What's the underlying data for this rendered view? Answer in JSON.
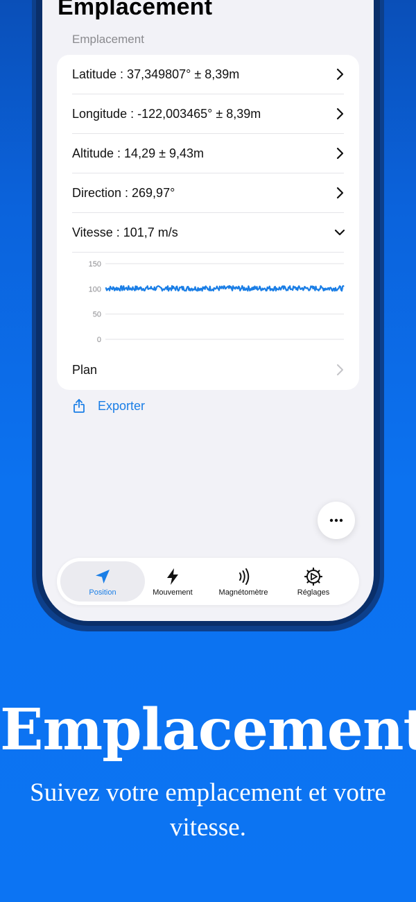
{
  "header": {
    "title": "Emplacement"
  },
  "section": {
    "label": "Emplacement"
  },
  "rows": [
    {
      "label": "Latitude : 37,349807° ± 8,39m",
      "expanded": false
    },
    {
      "label": "Longitude : -122,003465° ± 8,39m",
      "expanded": false
    },
    {
      "label": "Altitude : 14,29 ± 9,43m",
      "expanded": false
    },
    {
      "label": "Direction : 269,97°",
      "expanded": false
    },
    {
      "label": "Vitesse : 101,7 m/s",
      "expanded": true
    }
  ],
  "chart_data": {
    "type": "line",
    "y_ticks": [
      "150",
      "100",
      "50",
      "0"
    ],
    "ylim": [
      0,
      150
    ],
    "series": [
      {
        "values_approx": 101.7,
        "noise_range": [
          96,
          106
        ],
        "color": "#1a7ee6"
      }
    ],
    "grid": true
  },
  "plan": {
    "label": "Plan"
  },
  "export": {
    "label": "Exporter"
  },
  "fab": {
    "icon": "ellipsis-icon"
  },
  "tabs": [
    {
      "label": "Position",
      "icon": "location-arrow-icon",
      "active": true
    },
    {
      "label": "Mouvement",
      "icon": "bolt-icon",
      "active": false
    },
    {
      "label": "Magnétomètre",
      "icon": "signal-waves-icon",
      "active": false
    },
    {
      "label": "Réglages",
      "icon": "gear-icon",
      "active": false
    }
  ],
  "colors": {
    "accent": "#1a7ee6",
    "background": "#0c72f0"
  },
  "hero": {
    "title": "Emplacement",
    "subtitle": "Suivez votre emplacement et votre vitesse."
  }
}
